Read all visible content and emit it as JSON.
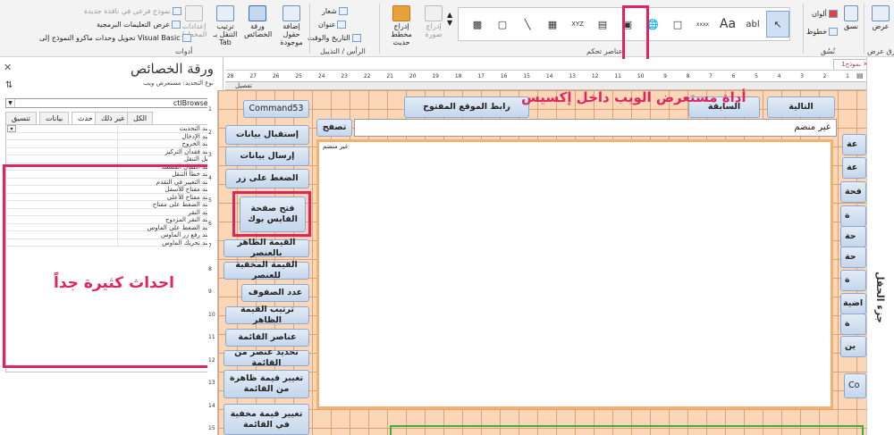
{
  "ribbon": {
    "views": {
      "label": "عرض",
      "group": "طرق عرض"
    },
    "themes": {
      "colors": "ألوان",
      "fonts": "خطوط",
      "themes_btn": "نسق",
      "group": "نُسُق"
    },
    "tools": {
      "add_fields": "إضافة حقول موجودة",
      "property_sheet": "ورقة الخصائص",
      "tab_order": "ترتيب التنقل بـ Tab",
      "tab_order_settings": "إعدادات المخطط",
      "subform_new_window": "نموذج فرعي في نافذة جديدة",
      "view_code": "عرض التعليمات البرمجية",
      "convert_macros": "تحويل وحدات ماكرو النموذج إلى Visual Basic",
      "group": "أدوات"
    },
    "header_footer": {
      "logo": "شعار",
      "title": "عنوان",
      "date_time": "التاريخ والوقت",
      "group": "الرأس / التذييل"
    },
    "controls": {
      "insert_image": "إدراج صورة",
      "insert_chart": "إدراج مخطط حديث",
      "group": "عناصر تحكم",
      "gallery_items": [
        "pointer-icon",
        "textbox-icon",
        "label-icon",
        "button-icon",
        "tab-icon",
        "hyperlink-icon",
        "web-browser-icon",
        "navigation-icon",
        "option-group-icon",
        "page-break-icon",
        "combo-box-icon",
        "chart-icon",
        "line-icon",
        "toggle-icon",
        "list-icon",
        "rectangle-icon"
      ]
    }
  },
  "props": {
    "title": "ورقة الخصائص",
    "selection_type_label": "نوع التحديد:",
    "selection_type_value": "مستعرض ويب",
    "object_name": "ctlBrowser",
    "tabs": [
      "تنسيق",
      "بيانات",
      "حدث",
      "غير ذلك",
      "الكل"
    ],
    "active_tab": 2,
    "rows": [
      {
        "name": "عند التحديث",
        "has_caret": true
      },
      {
        "name": "عند الإدخال"
      },
      {
        "name": "عند الخروج"
      },
      {
        "name": "عند فقدان التركيز"
      },
      {
        "name": "قبل التنقل"
      },
      {
        "name": "عند اكتمال المستند"
      },
      {
        "name": "عند خطأ التنقل"
      },
      {
        "name": "عند التغيير في التقدم"
      },
      {
        "name": "عند مفتاح للأسفل"
      },
      {
        "name": "عند مفتاح للأعلى"
      },
      {
        "name": "عند الضغط على مفتاح"
      },
      {
        "name": "عند النقر"
      },
      {
        "name": "عند النقر المزدوج"
      },
      {
        "name": "عند الضغط على الماوس"
      },
      {
        "name": "عند رفع زر الماوس"
      },
      {
        "name": "عند تحريك الماوس"
      }
    ],
    "annotation": "احداث كثيرة جداً"
  },
  "designer": {
    "doc_tab": "نموذج1",
    "section_label": "تفصيل",
    "ruler_h": [
      "1",
      "2",
      "3",
      "4",
      "5",
      "6",
      "7",
      "8",
      "9",
      "10",
      "11",
      "12",
      "13",
      "14",
      "15",
      "16",
      "17",
      "18",
      "19",
      "20",
      "21",
      "22",
      "23",
      "24",
      "25",
      "26",
      "27",
      "28"
    ],
    "ruler_v": [
      "1",
      "2",
      "3",
      "4",
      "5",
      "6",
      "7",
      "8",
      "9",
      "10",
      "11",
      "12",
      "13",
      "14",
      "15"
    ],
    "left_buttons": [
      "Command53",
      "إستقبال بيانات",
      "إرسال بيانات",
      "الضغط على زر",
      "فتح صفحة الفايس بوك",
      "القيمة الظاهر بالعنصر",
      "القيمة المخفية للعنصر",
      "عدد الصفوف",
      "ترتيب القيمة الظاهر",
      "عناصر القائمة",
      "تحديد عنصر من القائمة",
      "تغيير قيمة ظاهرة من القائمة",
      "تغيير قيمة مخفية في القائمة"
    ],
    "top_buttons": [
      "التالية",
      "السابقة",
      "رابط الموقع المفتوح"
    ],
    "browse_button": "تصفح",
    "unbound_text": "غير منضم",
    "web_ctrl_label": "غير منضم",
    "annotation": "أداة مستعرض الويب داخل إكسيس",
    "right_clipped": [
      "عة",
      "عة",
      "فحة",
      "ة",
      "حة",
      "حة",
      "ة",
      "اضية",
      "ة",
      "ين",
      "Co"
    ],
    "right_panel_label": "جزء الحقل"
  }
}
